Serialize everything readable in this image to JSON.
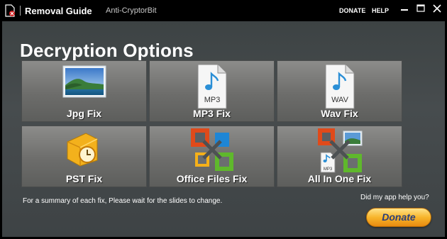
{
  "titlebar": {
    "title": "Removal Guide",
    "subtitle": "Anti-CryptorBit",
    "donate_link": "DONATE",
    "help_link": "HELP"
  },
  "main": {
    "heading": "Decryption Options",
    "tiles": [
      {
        "label": "Jpg Fix",
        "icon": "landscape-photo-icon"
      },
      {
        "label": "MP3 Fix",
        "icon": "mp3-file-icon",
        "icon_text": "MP3"
      },
      {
        "label": "Wav Fix",
        "icon": "wav-file-icon",
        "icon_text": "WAV"
      },
      {
        "label": "PST Fix",
        "icon": "outlook-pst-icon"
      },
      {
        "label": "Office Files Fix",
        "icon": "office-logo-icon"
      },
      {
        "label": "All In One Fix",
        "icon": "all-in-one-icon",
        "icon_text": "MP3"
      }
    ],
    "footer_note": "For a summary of each fix, Please wait for the slides to change.",
    "help_question": "Did my app help you?",
    "donate_button": "Donate"
  },
  "colors": {
    "background": "#444a4c",
    "tile": "#7a7a78",
    "donate_button": "#f7b52b",
    "donate_text": "#2a3f7a"
  }
}
